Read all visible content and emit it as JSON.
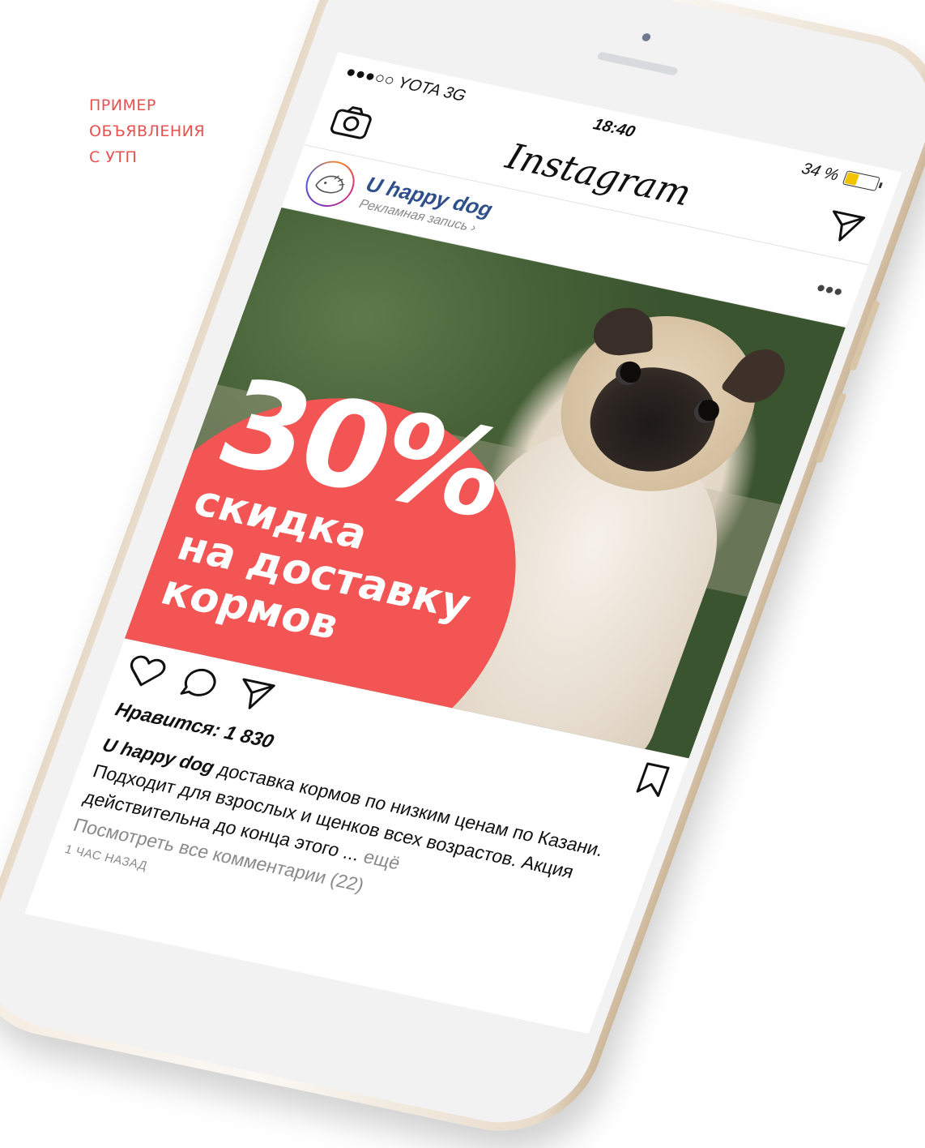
{
  "caption": {
    "lines": [
      "ПРИМЕР",
      "ОБЪЯВЛЕНИЯ",
      "С УТП"
    ],
    "color": "#e8514f"
  },
  "status_bar": {
    "carrier": "●●●○○ YOTA  3G",
    "time": "18:40",
    "battery": "34 %",
    "battery_level": 0.34
  },
  "app": {
    "logo": "Instagram",
    "icons": {
      "left": "camera-icon",
      "right": "direct-send-icon"
    }
  },
  "post": {
    "username": "U happy dog",
    "sponsored_label": "Рекламная запись",
    "more_label": "•••",
    "ad_image": {
      "headline": "30%",
      "line1": "скидка",
      "line2": "на доставку",
      "line3": "кормов",
      "circle_color": "#f25553"
    },
    "likes": "Нравится: 1 830",
    "caption_user": "U happy dog",
    "caption_text": "доставка кормов по низким ценам по Казани. Подходит для взрослых и щенков всех возрастов. Акция действительна до конца этого ...",
    "caption_more": "ещё",
    "comments_link": "Посмотреть все комментарии (22)",
    "time_ago": "1 ЧАС НАЗАД"
  }
}
